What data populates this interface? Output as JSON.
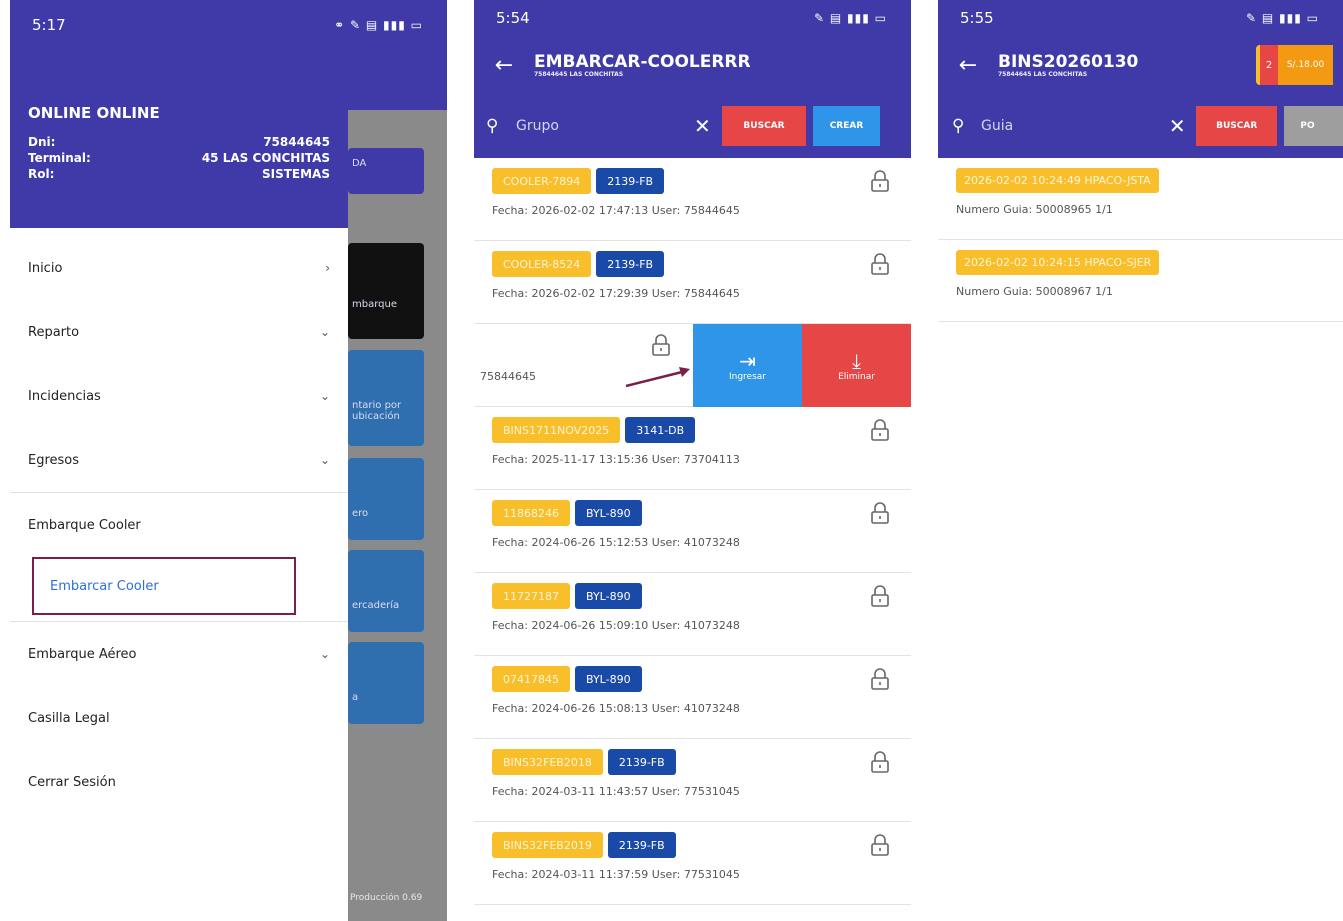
{
  "screen1": {
    "status": {
      "time": "5:17",
      "icons_right": "⚭ ✎ ▤ ▮▮▮ ▭"
    },
    "drawer": {
      "title": "ONLINE ONLINE",
      "info": [
        {
          "label": "Dni:",
          "value": "75844645"
        },
        {
          "label": "Terminal:",
          "value": "45 LAS CONCHITAS"
        },
        {
          "label": "Rol:",
          "value": "SISTEMAS"
        }
      ],
      "menu": [
        {
          "label": "Inicio",
          "chev": "›"
        },
        {
          "label": "Reparto",
          "chev": "⌄"
        },
        {
          "label": "Incidencias",
          "chev": "⌄"
        },
        {
          "label": "Egresos",
          "chev": "⌄"
        },
        {
          "label": "Embarque Cooler",
          "chev": ""
        }
      ],
      "submenu_selected": "Embarcar Cooler",
      "menu_after": [
        {
          "label": "Embarque Aéreo",
          "chev": "⌄"
        },
        {
          "label": "Casilla Legal",
          "chev": ""
        },
        {
          "label": "Cerrar Sesión",
          "chev": ""
        }
      ]
    },
    "background": {
      "card1": "DA",
      "card2": "mbarque",
      "card3": "ntario por ubicación",
      "card4": "ero",
      "card5": "ercadería",
      "card6": "a",
      "footer": "Producción 0.69"
    }
  },
  "screen2": {
    "status": {
      "time": "5:54",
      "icons_right": "✎ ▤ ▮▮▮ ▭"
    },
    "appbar": {
      "title": "EMBARCAR-COOLERRR",
      "subtitle": "75844645 LAS CONCHITAS"
    },
    "search": {
      "placeholder": "Grupo",
      "buscar": "BUSCAR",
      "crear": "CREAR"
    },
    "items_top": [
      {
        "tag1": "COOLER-7894",
        "tag2": "2139-FB",
        "meta": "Fecha: 2026-02-02 17:47:13   User: 75844645"
      },
      {
        "tag1": "COOLER-8524",
        "tag2": "2139-FB",
        "meta": "Fecha: 2026-02-02 17:29:39   User: 75844645"
      }
    ],
    "swipe": {
      "user": "75844645",
      "ingresar": "Ingresar",
      "eliminar": "Eliminar"
    },
    "items_bottom": [
      {
        "tag1": "BINS1711NOV2025",
        "tag2": "3141-DB",
        "meta": "Fecha: 2025-11-17 13:15:36   User: 73704113"
      },
      {
        "tag1": "11868246",
        "tag2": "BYL-890",
        "meta": "Fecha: 2024-06-26 15:12:53   User: 41073248"
      },
      {
        "tag1": "11727187",
        "tag2": "BYL-890",
        "meta": "Fecha: 2024-06-26 15:09:10   User: 41073248"
      },
      {
        "tag1": "07417845",
        "tag2": "BYL-890",
        "meta": "Fecha: 2024-06-26 15:08:13   User: 41073248"
      },
      {
        "tag1": "BINS32FEB2018",
        "tag2": "2139-FB",
        "meta": "Fecha: 2024-03-11 11:43:57   User: 77531045"
      },
      {
        "tag1": "BINS32FEB2019",
        "tag2": "2139-FB",
        "meta": "Fecha: 2024-03-11 11:37:59   User: 77531045"
      }
    ]
  },
  "screen3": {
    "status": {
      "time": "5:55",
      "icons_right": "✎ ▤ ▮▮▮ ▭"
    },
    "appbar": {
      "title": "BINS20260130",
      "subtitle": "75844645 LAS CONCHITAS",
      "badge_count": "2",
      "badge_price": "S/.18.00"
    },
    "search": {
      "placeholder": "Guia",
      "buscar": "BUSCAR",
      "grey": "PO"
    },
    "items": [
      {
        "tag": "2026-02-02 10:24:49 HPACO-JSTA",
        "meta": "Numero Guia: 50008965 1/1"
      },
      {
        "tag": "2026-02-02 10:24:15 HPACO-SJER",
        "meta": "Numero Guia: 50008967 1/1"
      }
    ]
  }
}
